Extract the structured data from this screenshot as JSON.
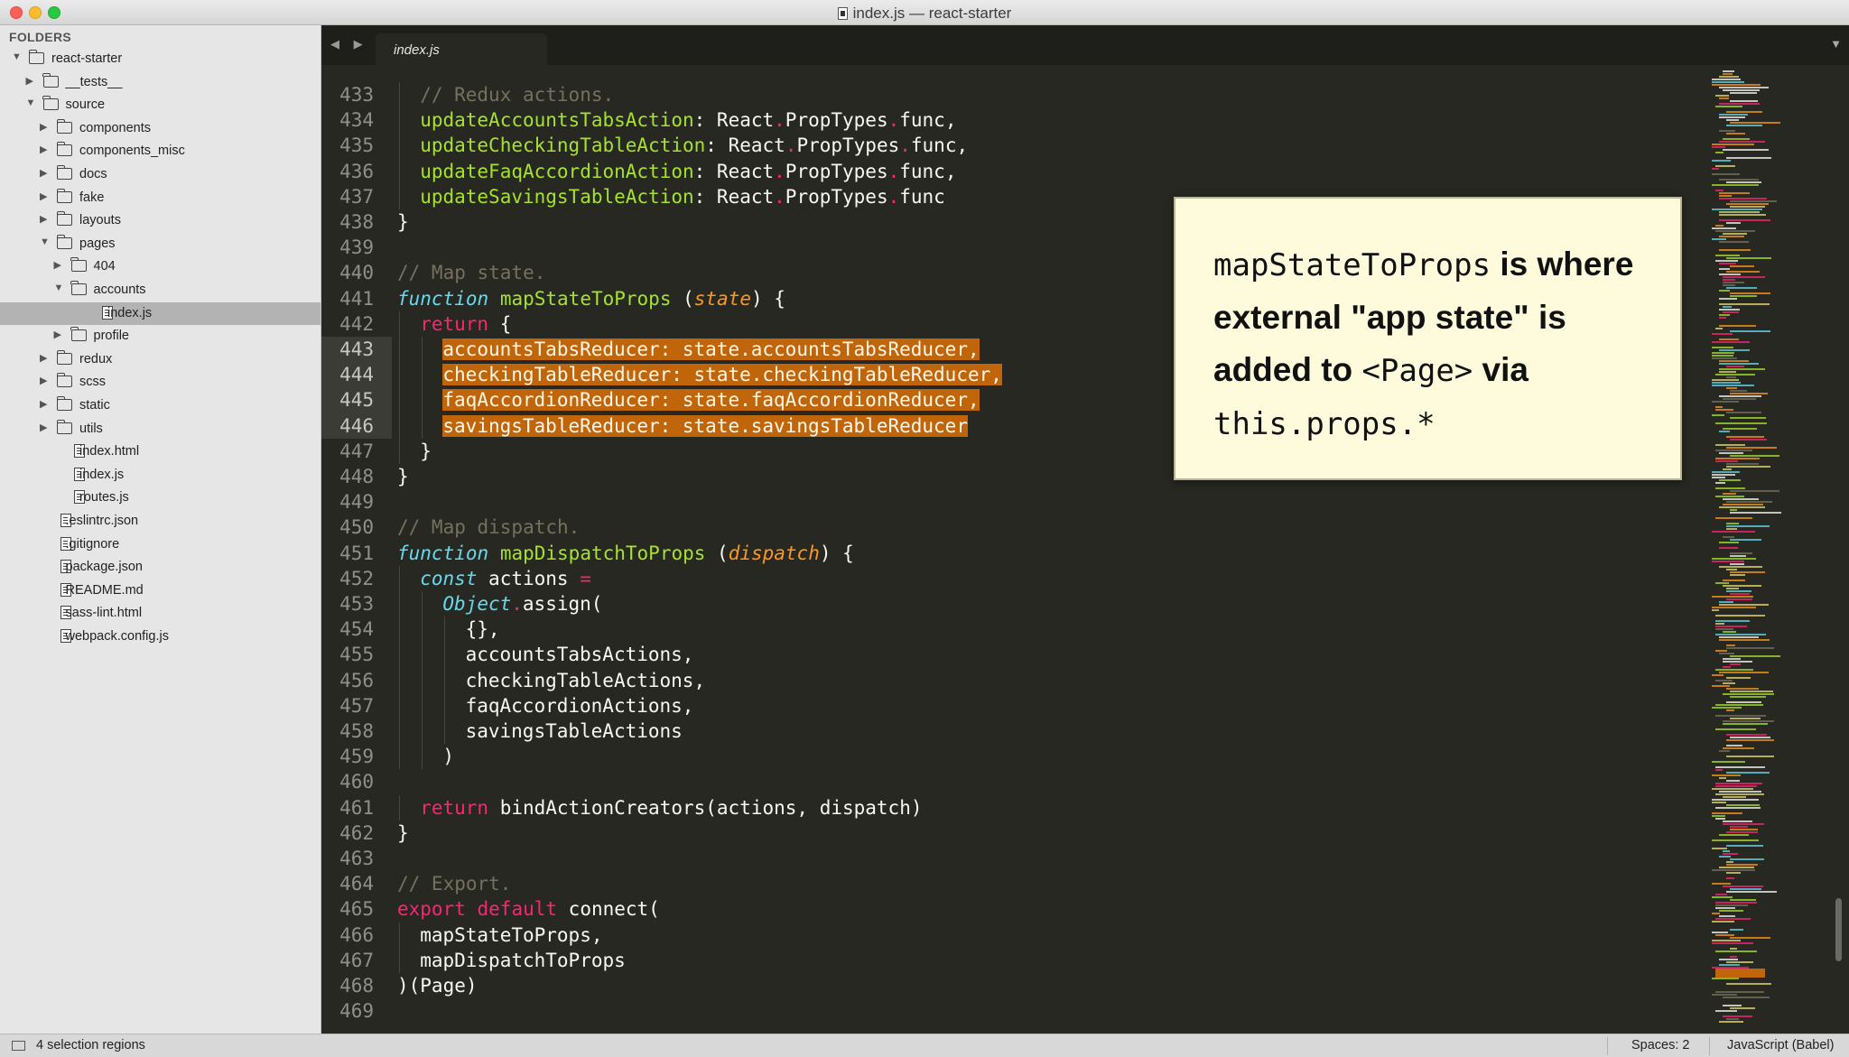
{
  "window": {
    "title": "index.js — react-starter"
  },
  "sidebar": {
    "header": "FOLDERS",
    "items": [
      {
        "label": "react-starter",
        "kind": "folder",
        "depth": 0,
        "expanded": true
      },
      {
        "label": "__tests__",
        "kind": "folder",
        "depth": 1,
        "expanded": false
      },
      {
        "label": "source",
        "kind": "folder",
        "depth": 1,
        "expanded": true
      },
      {
        "label": "components",
        "kind": "folder",
        "depth": 2,
        "expanded": false
      },
      {
        "label": "components_misc",
        "kind": "folder",
        "depth": 2,
        "expanded": false
      },
      {
        "label": "docs",
        "kind": "folder",
        "depth": 2,
        "expanded": false
      },
      {
        "label": "fake",
        "kind": "folder",
        "depth": 2,
        "expanded": false
      },
      {
        "label": "layouts",
        "kind": "folder",
        "depth": 2,
        "expanded": false
      },
      {
        "label": "pages",
        "kind": "folder",
        "depth": 2,
        "expanded": true
      },
      {
        "label": "404",
        "kind": "folder",
        "depth": 3,
        "expanded": false
      },
      {
        "label": "accounts",
        "kind": "folder",
        "depth": 3,
        "expanded": true
      },
      {
        "label": "index.js",
        "kind": "file",
        "depth": 4,
        "selected": true
      },
      {
        "label": "profile",
        "kind": "folder",
        "depth": 3,
        "expanded": false
      },
      {
        "label": "redux",
        "kind": "folder",
        "depth": 2,
        "expanded": false
      },
      {
        "label": "scss",
        "kind": "folder",
        "depth": 2,
        "expanded": false
      },
      {
        "label": "static",
        "kind": "folder",
        "depth": 2,
        "expanded": false
      },
      {
        "label": "utils",
        "kind": "folder",
        "depth": 2,
        "expanded": false
      },
      {
        "label": "index.html",
        "kind": "file",
        "depth": 2
      },
      {
        "label": "index.js",
        "kind": "file",
        "depth": 2
      },
      {
        "label": "routes.js",
        "kind": "file",
        "depth": 2
      },
      {
        "label": ".eslintrc.json",
        "kind": "file",
        "depth": 1
      },
      {
        "label": ".gitignore",
        "kind": "file",
        "depth": 1
      },
      {
        "label": "package.json",
        "kind": "file",
        "depth": 1
      },
      {
        "label": "README.md",
        "kind": "file",
        "depth": 1
      },
      {
        "label": "sass-lint.html",
        "kind": "file",
        "depth": 1
      },
      {
        "label": "webpack.config.js",
        "kind": "file",
        "depth": 1
      }
    ]
  },
  "tabbar": {
    "nav_arrows": "◀ ▶",
    "active_tab": "index.js",
    "dropdown": "▼"
  },
  "editor": {
    "lines": [
      {
        "n": "433",
        "i": 1,
        "t": [
          [
            "// Redux actions.",
            "comment"
          ]
        ]
      },
      {
        "n": "434",
        "i": 1,
        "t": [
          [
            "updateAccountsTabsAction",
            "key"
          ],
          [
            ": ",
            "punct"
          ],
          [
            "React",
            "plain"
          ],
          [
            ".",
            "op"
          ],
          [
            "PropTypes",
            "plain"
          ],
          [
            ".",
            "op"
          ],
          [
            "func",
            "plain"
          ],
          [
            ",",
            "punct"
          ]
        ]
      },
      {
        "n": "435",
        "i": 1,
        "t": [
          [
            "updateCheckingTableAction",
            "key"
          ],
          [
            ": ",
            "punct"
          ],
          [
            "React",
            "plain"
          ],
          [
            ".",
            "op"
          ],
          [
            "PropTypes",
            "plain"
          ],
          [
            ".",
            "op"
          ],
          [
            "func",
            "plain"
          ],
          [
            ",",
            "punct"
          ]
        ]
      },
      {
        "n": "436",
        "i": 1,
        "t": [
          [
            "updateFaqAccordionAction",
            "key"
          ],
          [
            ": ",
            "punct"
          ],
          [
            "React",
            "plain"
          ],
          [
            ".",
            "op"
          ],
          [
            "PropTypes",
            "plain"
          ],
          [
            ".",
            "op"
          ],
          [
            "func",
            "plain"
          ],
          [
            ",",
            "punct"
          ]
        ]
      },
      {
        "n": "437",
        "i": 1,
        "t": [
          [
            "updateSavingsTableAction",
            "key"
          ],
          [
            ": ",
            "punct"
          ],
          [
            "React",
            "plain"
          ],
          [
            ".",
            "op"
          ],
          [
            "PropTypes",
            "plain"
          ],
          [
            ".",
            "op"
          ],
          [
            "func",
            "plain"
          ]
        ]
      },
      {
        "n": "438",
        "i": 0,
        "t": [
          [
            "}",
            "plain"
          ]
        ]
      },
      {
        "n": "439",
        "i": 0,
        "t": []
      },
      {
        "n": "440",
        "i": 0,
        "t": [
          [
            "// Map state.",
            "comment"
          ]
        ]
      },
      {
        "n": "441",
        "i": 0,
        "t": [
          [
            "function",
            "storage"
          ],
          [
            " ",
            "plain"
          ],
          [
            "mapStateToProps",
            "func"
          ],
          [
            " (",
            "plain"
          ],
          [
            "state",
            "param"
          ],
          [
            ") {",
            "plain"
          ]
        ]
      },
      {
        "n": "442",
        "i": 1,
        "t": [
          [
            "return",
            "keyword"
          ],
          [
            " {",
            "plain"
          ]
        ]
      },
      {
        "n": "443",
        "i": 2,
        "sel": true,
        "t": [
          [
            "accountsTabsReducer: state.accountsTabsReducer,",
            "hl"
          ]
        ]
      },
      {
        "n": "444",
        "i": 2,
        "sel": true,
        "t": [
          [
            "checkingTableReducer: state.checkingTableReducer,",
            "hl"
          ]
        ]
      },
      {
        "n": "445",
        "i": 2,
        "sel": true,
        "t": [
          [
            "faqAccordionReducer: state.faqAccordionReducer,",
            "hl"
          ]
        ]
      },
      {
        "n": "446",
        "i": 2,
        "sel": true,
        "t": [
          [
            "savingsTableReducer: state.savingsTableReducer",
            "hl"
          ]
        ]
      },
      {
        "n": "447",
        "i": 1,
        "t": [
          [
            "}",
            "plain"
          ]
        ]
      },
      {
        "n": "448",
        "i": 0,
        "t": [
          [
            "}",
            "plain"
          ]
        ]
      },
      {
        "n": "449",
        "i": 0,
        "t": []
      },
      {
        "n": "450",
        "i": 0,
        "t": [
          [
            "// Map dispatch.",
            "comment"
          ]
        ]
      },
      {
        "n": "451",
        "i": 0,
        "t": [
          [
            "function",
            "storage"
          ],
          [
            " ",
            "plain"
          ],
          [
            "mapDispatchToProps",
            "func"
          ],
          [
            " (",
            "plain"
          ],
          [
            "dispatch",
            "param"
          ],
          [
            ") {",
            "plain"
          ]
        ]
      },
      {
        "n": "452",
        "i": 1,
        "t": [
          [
            "const",
            "storage"
          ],
          [
            " actions ",
            "plain"
          ],
          [
            "=",
            "op"
          ]
        ]
      },
      {
        "n": "453",
        "i": 2,
        "t": [
          [
            "Object",
            "class"
          ],
          [
            ".",
            "op"
          ],
          [
            "assign(",
            "plain"
          ]
        ]
      },
      {
        "n": "454",
        "i": 3,
        "t": [
          [
            "{},",
            "plain"
          ]
        ]
      },
      {
        "n": "455",
        "i": 3,
        "t": [
          [
            "accountsTabsActions,",
            "plain"
          ]
        ]
      },
      {
        "n": "456",
        "i": 3,
        "t": [
          [
            "checkingTableActions,",
            "plain"
          ]
        ]
      },
      {
        "n": "457",
        "i": 3,
        "t": [
          [
            "faqAccordionActions,",
            "plain"
          ]
        ]
      },
      {
        "n": "458",
        "i": 3,
        "t": [
          [
            "savingsTableActions",
            "plain"
          ]
        ]
      },
      {
        "n": "459",
        "i": 2,
        "t": [
          [
            ")",
            "plain"
          ]
        ]
      },
      {
        "n": "460",
        "i": 0,
        "t": []
      },
      {
        "n": "461",
        "i": 1,
        "t": [
          [
            "return",
            "keyword"
          ],
          [
            " bindActionCreators(actions, dispatch)",
            "plain"
          ]
        ]
      },
      {
        "n": "462",
        "i": 0,
        "t": [
          [
            "}",
            "plain"
          ]
        ]
      },
      {
        "n": "463",
        "i": 0,
        "t": []
      },
      {
        "n": "464",
        "i": 0,
        "t": [
          [
            "// Export.",
            "comment"
          ]
        ]
      },
      {
        "n": "465",
        "i": 0,
        "t": [
          [
            "export",
            "keyword"
          ],
          [
            " ",
            "plain"
          ],
          [
            "default",
            "keyword"
          ],
          [
            " connect(",
            "plain"
          ]
        ]
      },
      {
        "n": "466",
        "i": 1,
        "t": [
          [
            "mapStateToProps,",
            "plain"
          ]
        ]
      },
      {
        "n": "467",
        "i": 1,
        "t": [
          [
            "mapDispatchToProps",
            "plain"
          ]
        ]
      },
      {
        "n": "468",
        "i": 0,
        "t": [
          [
            ")(Page)",
            "plain"
          ]
        ]
      },
      {
        "n": "469",
        "i": 0,
        "t": []
      }
    ]
  },
  "callout": {
    "code_1": "mapStateToProps",
    "text_1": " is where external \"app state\" is added to ",
    "code_2": "<Page>",
    "text_2": " via ",
    "code_3": "this.props.*"
  },
  "statusbar": {
    "selection": "4 selection regions",
    "spaces": "Spaces: 2",
    "syntax": "JavaScript (Babel)"
  },
  "colors": {
    "editor_bg": "#272822",
    "selection_highlight": "#c1650b",
    "comment": "#75715e",
    "keyword": "#f92672",
    "storage": "#66d9ef",
    "function_name": "#a6e22e",
    "parameter": "#fd971f",
    "callout_bg": "#fdfbdc"
  }
}
